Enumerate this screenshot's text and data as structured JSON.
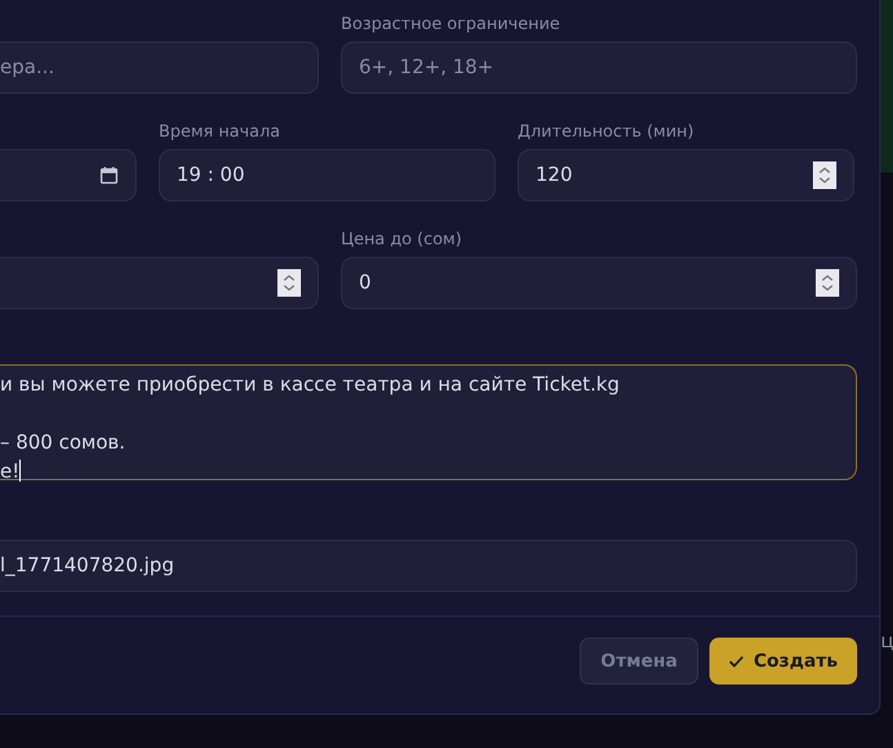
{
  "rows": [
    {
      "fields": [
        {
          "kind": "text",
          "placeholder": "ера..."
        },
        {
          "kind": "text",
          "label": "Возрастное ограничение",
          "placeholder": "6+, 12+, 18+"
        }
      ]
    },
    {
      "fields": [
        {
          "kind": "date"
        },
        {
          "kind": "time",
          "label": "Время начала",
          "value": "19 : 00"
        },
        {
          "kind": "number",
          "label": "Длительность (мин)",
          "value": "120"
        }
      ]
    },
    {
      "fields": [
        {
          "kind": "number"
        },
        {
          "kind": "number",
          "label": "Цена до (сом)",
          "value": "0"
        }
      ]
    }
  ],
  "description": {
    "focused": true,
    "paragraphs": [
      [
        "и вы можете приобрести в кассе театра и на сайте Ticket.kg"
      ],
      [
        "– 800 сомов.",
        "е!"
      ]
    ]
  },
  "image_file": {
    "value": "l_1771407820.jpg"
  },
  "buttons": [
    {
      "kind": "cancel",
      "label": "Отмена"
    },
    {
      "kind": "create",
      "label": "Создать"
    }
  ],
  "background_fragment": "ц"
}
